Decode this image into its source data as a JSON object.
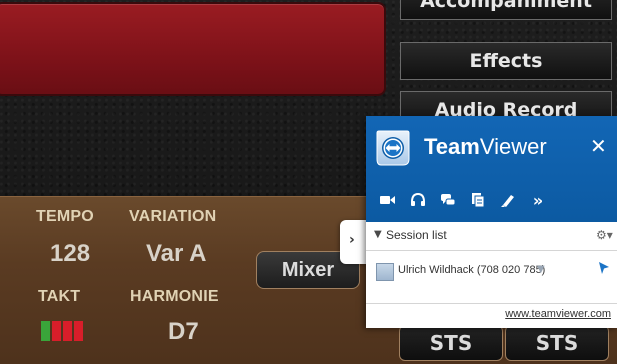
{
  "menu": {
    "accompaniment": "Accompaniment",
    "effects": "Effects",
    "audio_record": "Audio Record"
  },
  "status": {
    "tempo_label": "TEMPO",
    "tempo_value": "128",
    "variation_label": "VARIATION",
    "variation_value": "Var A",
    "takt_label": "TAKT",
    "harmonie_label": "HARMONIE",
    "harmonie_value": "D7"
  },
  "buttons": {
    "mixer": "Mixer",
    "sts_1": "STS",
    "sts_2": "STS"
  },
  "takt_colors": [
    "#3aa53a",
    "#d81e2a",
    "#d81e2a",
    "#d81e2a"
  ],
  "teamviewer": {
    "title_bold": "Team",
    "title_regular": "Viewer",
    "close": "✕",
    "tools": [
      "video-icon",
      "headset-icon",
      "chat-icon",
      "files-icon",
      "whiteboard-icon",
      "more-icon"
    ],
    "more": "»",
    "session_list": "Session list",
    "user": "Ulrich Wildhack (708 020 785)",
    "link": "www.teamviewer.com",
    "brand_color": "#0e5ea8"
  }
}
